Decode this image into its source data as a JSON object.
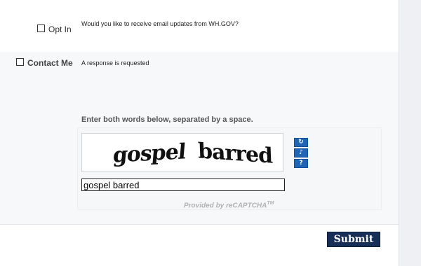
{
  "form": {
    "optin": {
      "label": "Opt In",
      "description": "Would you like to receive email updates from WH.GOV?",
      "checked": false
    },
    "contact": {
      "label": "Contact Me",
      "description": "A response is requested",
      "checked": false
    }
  },
  "captcha": {
    "instruction": "Enter both words below, separated by a space.",
    "word1": "gospel",
    "word2": "barred",
    "input_value": "gospel barred",
    "refresh_icon": "refresh-icon",
    "audio_icon": "audio-icon",
    "help_icon": "help-icon",
    "provided_by": "Provided by reCAPTCHA",
    "trademark": "TM"
  },
  "actions": {
    "submit_label": "Submit"
  },
  "colors": {
    "submit_bg": "#172e57",
    "captcha_btn_bg": "#1f66b7",
    "row_alt_bg": "#f7f8fa"
  }
}
